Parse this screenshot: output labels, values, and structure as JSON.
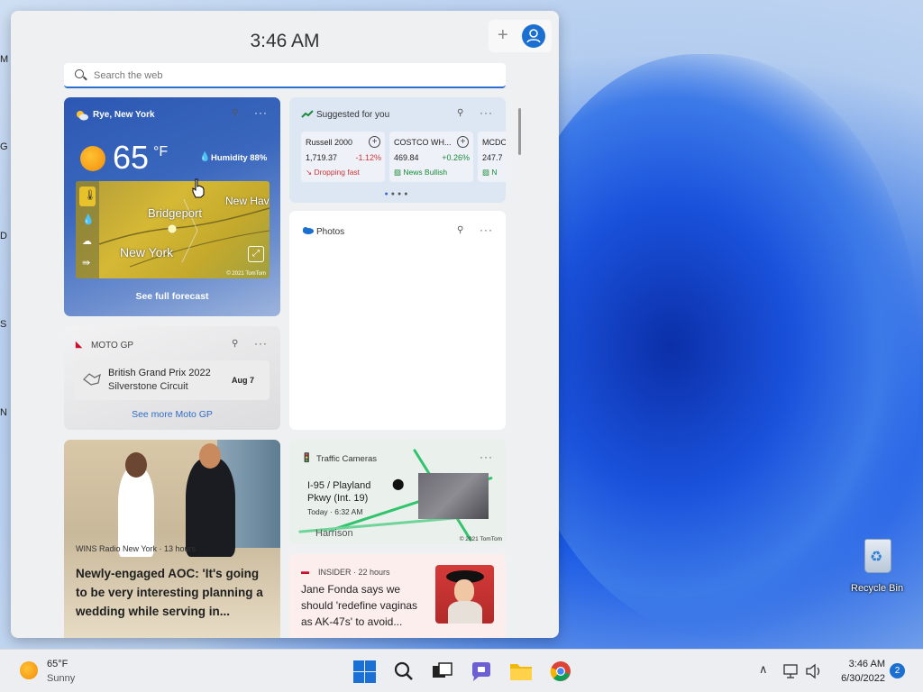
{
  "desktop": {
    "recycle_bin_label": "Recycle Bin",
    "left_edge_letters": [
      "M",
      "G",
      "D",
      "S",
      "N"
    ]
  },
  "widgets": {
    "time": "3:46 AM",
    "search_placeholder": "Search the web",
    "weather": {
      "location": "Rye, New York",
      "temperature": "65",
      "unit": "°F",
      "humidity": "Humidity 88%",
      "map_labels": [
        "Bridgeport",
        "New Hav",
        "New York"
      ],
      "map_copyright": "© 2021 TomTom",
      "forecast_link": "See full forecast"
    },
    "stocks": {
      "header": "Suggested for you",
      "items": [
        {
          "name": "Russell 2000",
          "price": "1,719.37",
          "change": "-1.12%",
          "trend": "Dropping fast",
          "color": "#d13438"
        },
        {
          "name": "COSTCO WH...",
          "price": "469.84",
          "change": "+0.26%",
          "trend": "News Bullish",
          "color": "#1a8a3a"
        },
        {
          "name": "MCDO",
          "price": "247.7",
          "change": "",
          "trend": "N",
          "color": "#1a8a3a"
        }
      ]
    },
    "photos": {
      "header": "Photos"
    },
    "motogp": {
      "header": "MOTO GP",
      "event": "British Grand Prix 2022",
      "venue": "Silverstone Circuit",
      "date": "Aug 7",
      "more": "See more Moto GP"
    },
    "news1": {
      "source": "WINS Radio New York · 13 hours",
      "title": "Newly-engaged AOC: 'It's going to be very interesting planning a wedding while serving in..."
    },
    "traffic": {
      "header": "Traffic Cameras",
      "location_line1": "I-95 / Playland",
      "location_line2": "Pkwy (Int. 19)",
      "time": "Today · 6:32 AM",
      "map_label": "Harrison",
      "copyright": "© 2021 TomTom"
    },
    "news2": {
      "source": "INSIDER · 22 hours",
      "title": "Jane Fonda says we should 'redefine vaginas as AK-47s' to avoid..."
    }
  },
  "taskbar": {
    "weather_temp": "65°F",
    "weather_cond": "Sunny",
    "time": "3:46 AM",
    "date": "6/30/2022",
    "notifications": "2"
  }
}
